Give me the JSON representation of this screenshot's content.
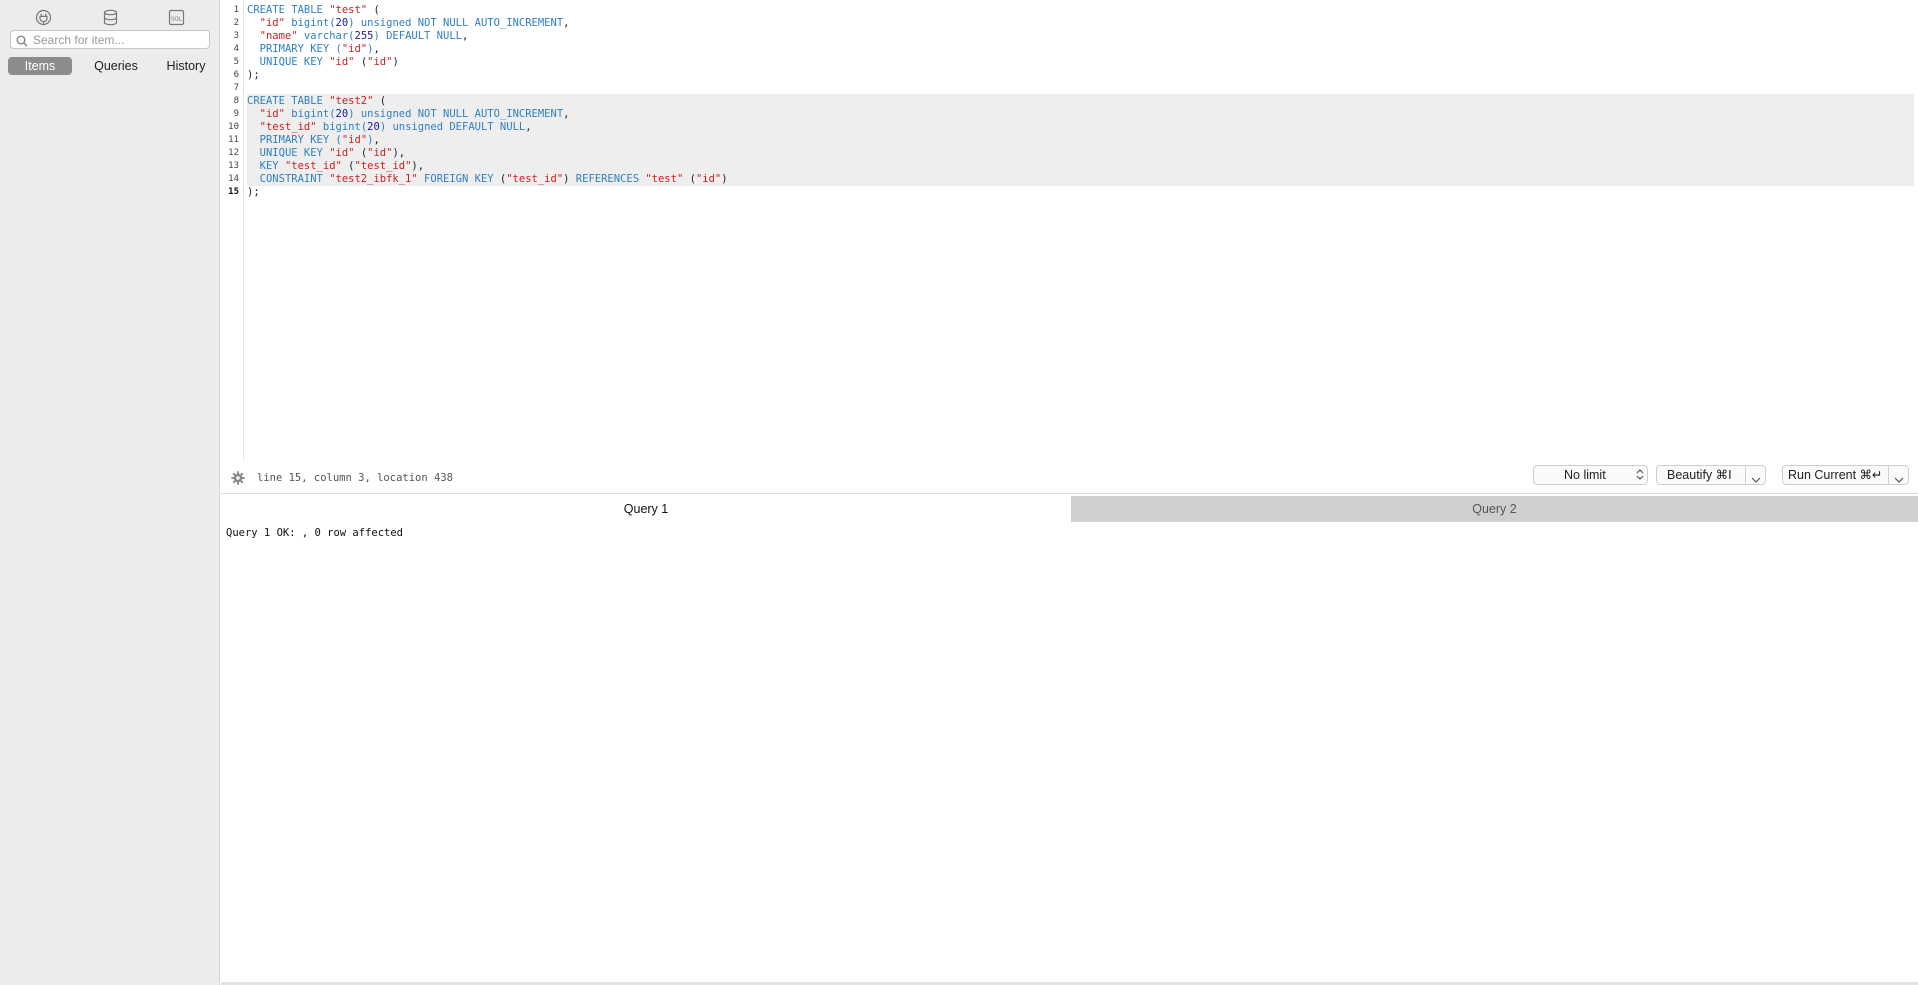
{
  "sidebar": {
    "icons": [
      "plug-icon",
      "database-icon",
      "sql-file-icon"
    ],
    "sql_icon_text": "SQL",
    "search": {
      "placeholder": "Search for item...",
      "value": ""
    },
    "tabs": [
      "Items",
      "Queries",
      "History"
    ],
    "active_tab": "Items"
  },
  "editor": {
    "line_numbers": [
      "1",
      "2",
      "3",
      "4",
      "5",
      "6",
      "7",
      "8",
      "9",
      "10",
      "11",
      "12",
      "13",
      "14",
      "15"
    ],
    "current_line": "15",
    "lines": [
      [
        [
          "kw",
          "CREATE TABLE "
        ],
        [
          "str",
          "\"test\""
        ],
        [
          "pl",
          " ("
        ]
      ],
      [
        [
          "pl",
          "  "
        ],
        [
          "str",
          "\"id\""
        ],
        [
          "pl",
          " "
        ],
        [
          "kw",
          "bigint("
        ],
        [
          "num",
          "20"
        ],
        [
          "kw",
          ") unsigned NOT NULL AUTO_INCREMENT"
        ],
        [
          "pl",
          ","
        ]
      ],
      [
        [
          "pl",
          "  "
        ],
        [
          "str",
          "\"name\""
        ],
        [
          "pl",
          " "
        ],
        [
          "kw",
          "varchar("
        ],
        [
          "num",
          "255"
        ],
        [
          "kw",
          ") DEFAULT NULL"
        ],
        [
          "pl",
          ","
        ]
      ],
      [
        [
          "pl",
          "  "
        ],
        [
          "kw",
          "PRIMARY KEY ("
        ],
        [
          "str",
          "\"id\""
        ],
        [
          "kw",
          ")"
        ],
        [
          "pl",
          ","
        ]
      ],
      [
        [
          "pl",
          "  "
        ],
        [
          "kw",
          "UNIQUE KEY "
        ],
        [
          "str",
          "\"id\""
        ],
        [
          "pl",
          " ("
        ],
        [
          "str",
          "\"id\""
        ],
        [
          "pl",
          ")"
        ]
      ],
      [
        [
          "pl",
          ");"
        ]
      ],
      [
        [
          "pl",
          ""
        ]
      ],
      [
        [
          "kw",
          "CREATE TABLE "
        ],
        [
          "str",
          "\"test2\""
        ],
        [
          "pl",
          " ("
        ]
      ],
      [
        [
          "pl",
          "  "
        ],
        [
          "str",
          "\"id\""
        ],
        [
          "pl",
          " "
        ],
        [
          "kw",
          "bigint("
        ],
        [
          "num",
          "20"
        ],
        [
          "kw",
          ") unsigned NOT NULL AUTO_INCREMENT"
        ],
        [
          "pl",
          ","
        ]
      ],
      [
        [
          "pl",
          "  "
        ],
        [
          "str",
          "\"test_id\""
        ],
        [
          "pl",
          " "
        ],
        [
          "kw",
          "bigint("
        ],
        [
          "num",
          "20"
        ],
        [
          "kw",
          ") unsigned DEFAULT NULL"
        ],
        [
          "pl",
          ","
        ]
      ],
      [
        [
          "pl",
          "  "
        ],
        [
          "kw",
          "PRIMARY KEY ("
        ],
        [
          "str",
          "\"id\""
        ],
        [
          "kw",
          ")"
        ],
        [
          "pl",
          ","
        ]
      ],
      [
        [
          "pl",
          "  "
        ],
        [
          "kw",
          "UNIQUE KEY "
        ],
        [
          "str",
          "\"id\""
        ],
        [
          "pl",
          " ("
        ],
        [
          "str",
          "\"id\""
        ],
        [
          "pl",
          "),"
        ]
      ],
      [
        [
          "pl",
          "  "
        ],
        [
          "kw",
          "KEY "
        ],
        [
          "str",
          "\"test_id\""
        ],
        [
          "pl",
          " ("
        ],
        [
          "str",
          "\"test_id\""
        ],
        [
          "pl",
          "),"
        ]
      ],
      [
        [
          "pl",
          "  "
        ],
        [
          "kw",
          "CONSTRAINT "
        ],
        [
          "str",
          "\"test2_ibfk_1\""
        ],
        [
          "pl",
          " "
        ],
        [
          "kw",
          "FOREIGN KEY "
        ],
        [
          "pl",
          "("
        ],
        [
          "str",
          "\"test_id\""
        ],
        [
          "pl",
          ") "
        ],
        [
          "kw",
          "REFERENCES "
        ],
        [
          "str",
          "\"test\""
        ],
        [
          "pl",
          " ("
        ],
        [
          "str",
          "\"id\""
        ],
        [
          "pl",
          ")"
        ]
      ],
      [
        [
          "pl",
          ");"
        ]
      ]
    ]
  },
  "statusbar": {
    "cursor_info": "line 15, column 3, location 438",
    "limit_select": "No limit",
    "beautify_label": "Beautify ⌘I",
    "run_label": "Run Current ⌘↵"
  },
  "results": {
    "tabs": [
      "Query 1",
      "Query 2"
    ],
    "active_tab": "Query 1",
    "message": "Query 1 OK: , 0 row affected"
  },
  "colors": {
    "sidebar_bg": "#ececec",
    "keyword": "#2f7fc1",
    "string": "#c82020",
    "number": "#1a1aa6",
    "active_tab_bg": "#8c8c8c",
    "inactive_result_tab_bg": "#cfcfcf",
    "highlight_bg": "#eeeeee"
  }
}
